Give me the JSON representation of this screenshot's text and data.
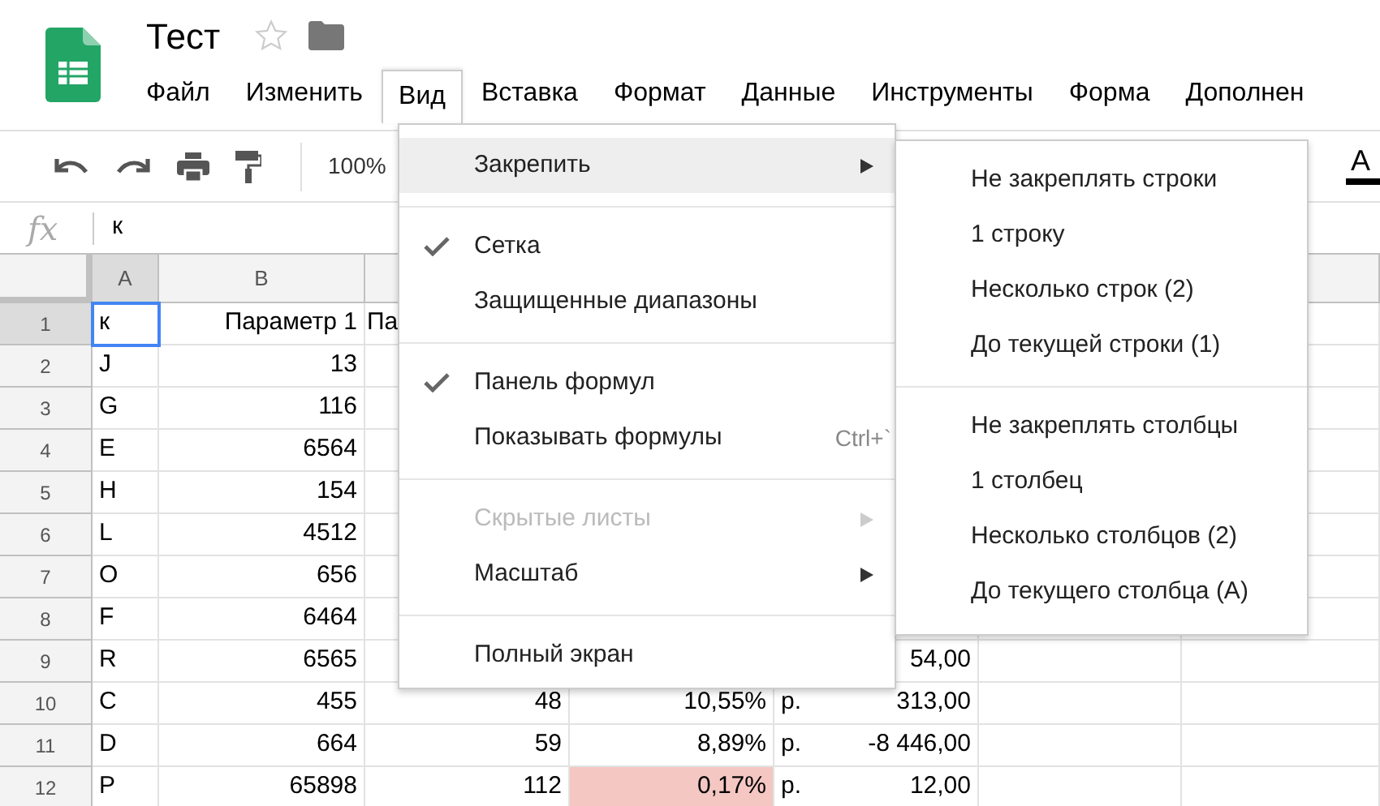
{
  "app": {
    "title": "Тест",
    "starred": false
  },
  "menu_bar": [
    {
      "label": "Файл",
      "selected": false
    },
    {
      "label": "Изменить",
      "selected": false
    },
    {
      "label": "Вид",
      "selected": true
    },
    {
      "label": "Вставка",
      "selected": false
    },
    {
      "label": "Формат",
      "selected": false
    },
    {
      "label": "Данные",
      "selected": false
    },
    {
      "label": "Инструменты",
      "selected": false
    },
    {
      "label": "Форма",
      "selected": false
    },
    {
      "label": "Дополнен",
      "selected": false
    }
  ],
  "toolbar": {
    "zoom": "100%",
    "text_color_label": "A"
  },
  "formula_bar": {
    "label": "fx",
    "value": "к"
  },
  "sheet": {
    "columns": [
      {
        "label": "A",
        "selected": true
      },
      {
        "label": "B",
        "selected": false
      }
    ],
    "rows": [
      {
        "row": "1",
        "selected": true,
        "A": "к",
        "A_selected": true,
        "B": "Параметр 1",
        "C": "Па"
      },
      {
        "row": "2",
        "selected": false,
        "A": "J",
        "A_selected": false,
        "B": "13"
      },
      {
        "row": "3",
        "selected": false,
        "A": "G",
        "A_selected": false,
        "B": "116"
      },
      {
        "row": "4",
        "selected": false,
        "A": "E",
        "A_selected": false,
        "B": "6564"
      },
      {
        "row": "5",
        "selected": false,
        "A": "H",
        "A_selected": false,
        "B": "154"
      },
      {
        "row": "6",
        "selected": false,
        "A": "L",
        "A_selected": false,
        "B": "4512"
      },
      {
        "row": "7",
        "selected": false,
        "A": "O",
        "A_selected": false,
        "B": "656"
      },
      {
        "row": "8",
        "selected": false,
        "A": "F",
        "A_selected": false,
        "B": "6464"
      },
      {
        "row": "9",
        "selected": false,
        "A": "R",
        "A_selected": false,
        "B": "6565",
        "E": {
          "amount": "54,00"
        }
      },
      {
        "row": "10",
        "selected": false,
        "A": "C",
        "A_selected": false,
        "B": "455",
        "C": "48",
        "D": "10,55%",
        "D_highlighted": false,
        "E": {
          "currency": "р.",
          "amount": "313,00"
        }
      },
      {
        "row": "11",
        "selected": false,
        "A": "D",
        "A_selected": false,
        "B": "664",
        "C": "59",
        "D": "8,89%",
        "D_highlighted": false,
        "E": {
          "currency": "р.",
          "amount": "-8 446,00"
        }
      },
      {
        "row": "12",
        "selected": false,
        "A": "P",
        "A_selected": false,
        "B": "65898",
        "C": "112",
        "D": "0,17%",
        "D_highlighted": true,
        "E": {
          "currency": "р.",
          "amount": "12,00"
        }
      }
    ]
  },
  "view_menu": {
    "items": [
      {
        "kind": "item",
        "label": "Закрепить",
        "highlighted": true,
        "checked": false,
        "disabled": false,
        "submenu": true
      },
      {
        "kind": "divider"
      },
      {
        "kind": "item",
        "label": "Сетка",
        "highlighted": false,
        "checked": true,
        "disabled": false,
        "submenu": false
      },
      {
        "kind": "item",
        "label": "Защищенные диапазоны",
        "highlighted": false,
        "checked": false,
        "disabled": false,
        "submenu": false
      },
      {
        "kind": "divider"
      },
      {
        "kind": "item",
        "label": "Панель формул",
        "highlighted": false,
        "checked": true,
        "disabled": false,
        "submenu": false
      },
      {
        "kind": "item",
        "label": "Показывать формулы",
        "shortcut": "Ctrl+`",
        "highlighted": false,
        "checked": false,
        "disabled": false,
        "submenu": false
      },
      {
        "kind": "divider"
      },
      {
        "kind": "item",
        "label": "Скрытые листы",
        "highlighted": false,
        "checked": false,
        "disabled": true,
        "submenu": true
      },
      {
        "kind": "item",
        "label": "Масштаб",
        "highlighted": false,
        "checked": false,
        "disabled": false,
        "submenu": true
      },
      {
        "kind": "divider"
      },
      {
        "kind": "item",
        "label": "Полный экран",
        "highlighted": false,
        "checked": false,
        "disabled": false,
        "submenu": false
      }
    ]
  },
  "freeze_submenu": {
    "items": [
      {
        "kind": "item",
        "label": "Не закреплять строки"
      },
      {
        "kind": "item",
        "label": "1 строку"
      },
      {
        "kind": "item",
        "label": "Несколько строк (2)"
      },
      {
        "kind": "item",
        "label": "До текущей строки (1)"
      },
      {
        "kind": "divider"
      },
      {
        "kind": "item",
        "label": "Не закреплять столбцы"
      },
      {
        "kind": "item",
        "label": "1 столбец"
      },
      {
        "kind": "item",
        "label": "Несколько столбцов (2)"
      },
      {
        "kind": "item",
        "label": "До текущего столбца (A)"
      }
    ]
  }
}
